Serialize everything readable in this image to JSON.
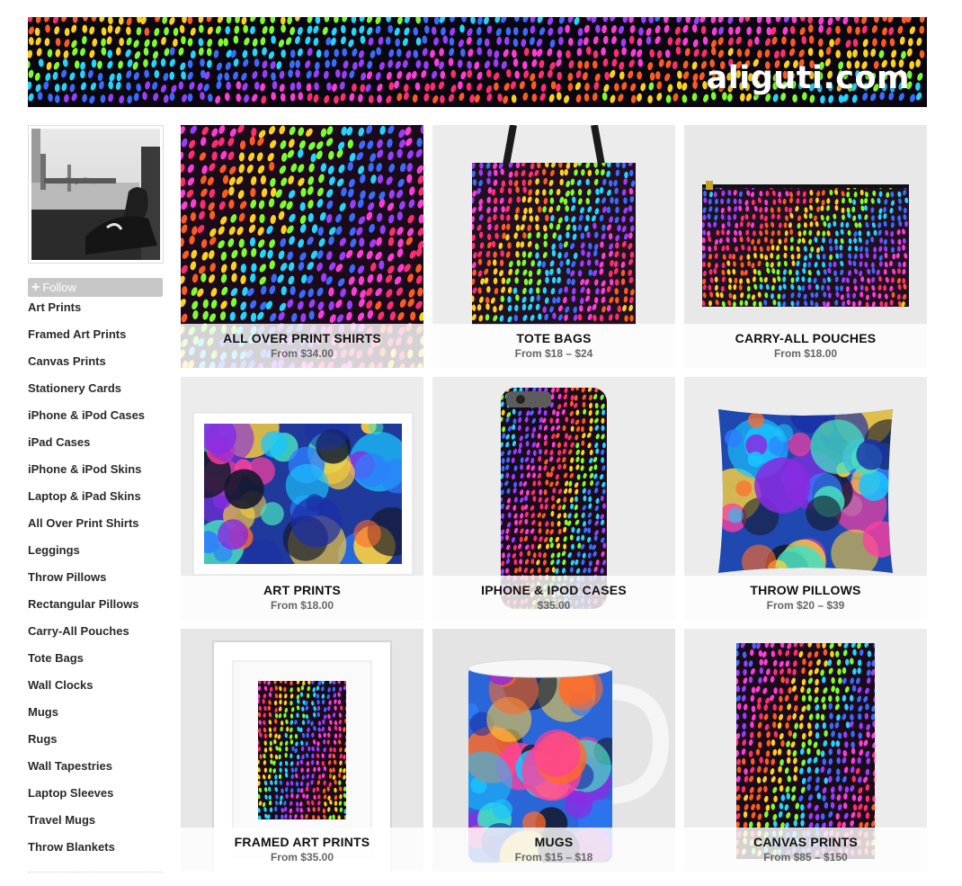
{
  "banner": {
    "title": "aliguti.com"
  },
  "sidebar": {
    "follow_label": "Follow",
    "items": [
      "Art Prints",
      "Framed Art Prints",
      "Canvas Prints",
      "Stationery Cards",
      "iPhone & iPod Cases",
      "iPad Cases",
      "iPhone & iPod Skins",
      "Laptop & iPad Skins",
      "All Over Print Shirts",
      "Leggings",
      "Throw Pillows",
      "Rectangular Pillows",
      "Carry-All Pouches",
      "Tote Bags",
      "Wall Clocks",
      "Mugs",
      "Rugs",
      "Wall Tapestries",
      "Laptop Sleeves",
      "Travel Mugs",
      "Throw Blankets"
    ]
  },
  "products": [
    {
      "name": "ALL OVER PRINT SHIRTS",
      "price": "From $34.00"
    },
    {
      "name": "TOTE BAGS",
      "price": "From $18 – $24"
    },
    {
      "name": "CARRY-ALL POUCHES",
      "price": "From $18.00"
    },
    {
      "name": "ART PRINTS",
      "price": "From $18.00"
    },
    {
      "name": "IPHONE & IPOD CASES",
      "price": "$35.00"
    },
    {
      "name": "THROW PILLOWS",
      "price": "From $20 – $39"
    },
    {
      "name": "FRAMED ART PRINTS",
      "price": "From $35.00"
    },
    {
      "name": "MUGS",
      "price": "From $15 – $18"
    },
    {
      "name": "CANVAS PRINTS",
      "price": "From $85 – $150"
    }
  ],
  "colors": {
    "follow_button": "#c7c7c7",
    "card_background": "#eaeaea",
    "pattern": [
      "#ff2d6f",
      "#ff5a1f",
      "#ffd21a",
      "#7dff2a",
      "#22d6ff",
      "#3a6bff",
      "#9b3cff",
      "#ff3cd9"
    ]
  }
}
